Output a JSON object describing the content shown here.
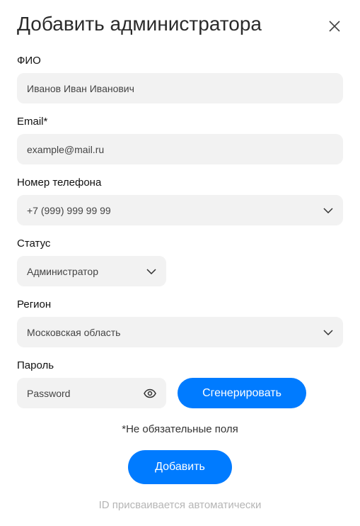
{
  "title": "Добавить администратора",
  "fields": {
    "fio": {
      "label": "ФИО",
      "value": "Иванов Иван Иванович"
    },
    "email": {
      "label": "Email*",
      "value": "example@mail.ru"
    },
    "phone": {
      "label": "Номер телефона",
      "value": "+7 (999) 999 99 99"
    },
    "status": {
      "label": "Статус",
      "value": "Администратор"
    },
    "region": {
      "label": "Регион",
      "value": "Московская область"
    },
    "password": {
      "label": "Пароль",
      "placeholder": "Password"
    }
  },
  "generate_label": "Сгенерировать",
  "optional_note": "*Не обязательные поля",
  "submit_label": "Добавить",
  "id_note": "ID присваивается автоматически",
  "colors": {
    "accent": "#007bff",
    "field_bg": "#f2f2f2"
  }
}
